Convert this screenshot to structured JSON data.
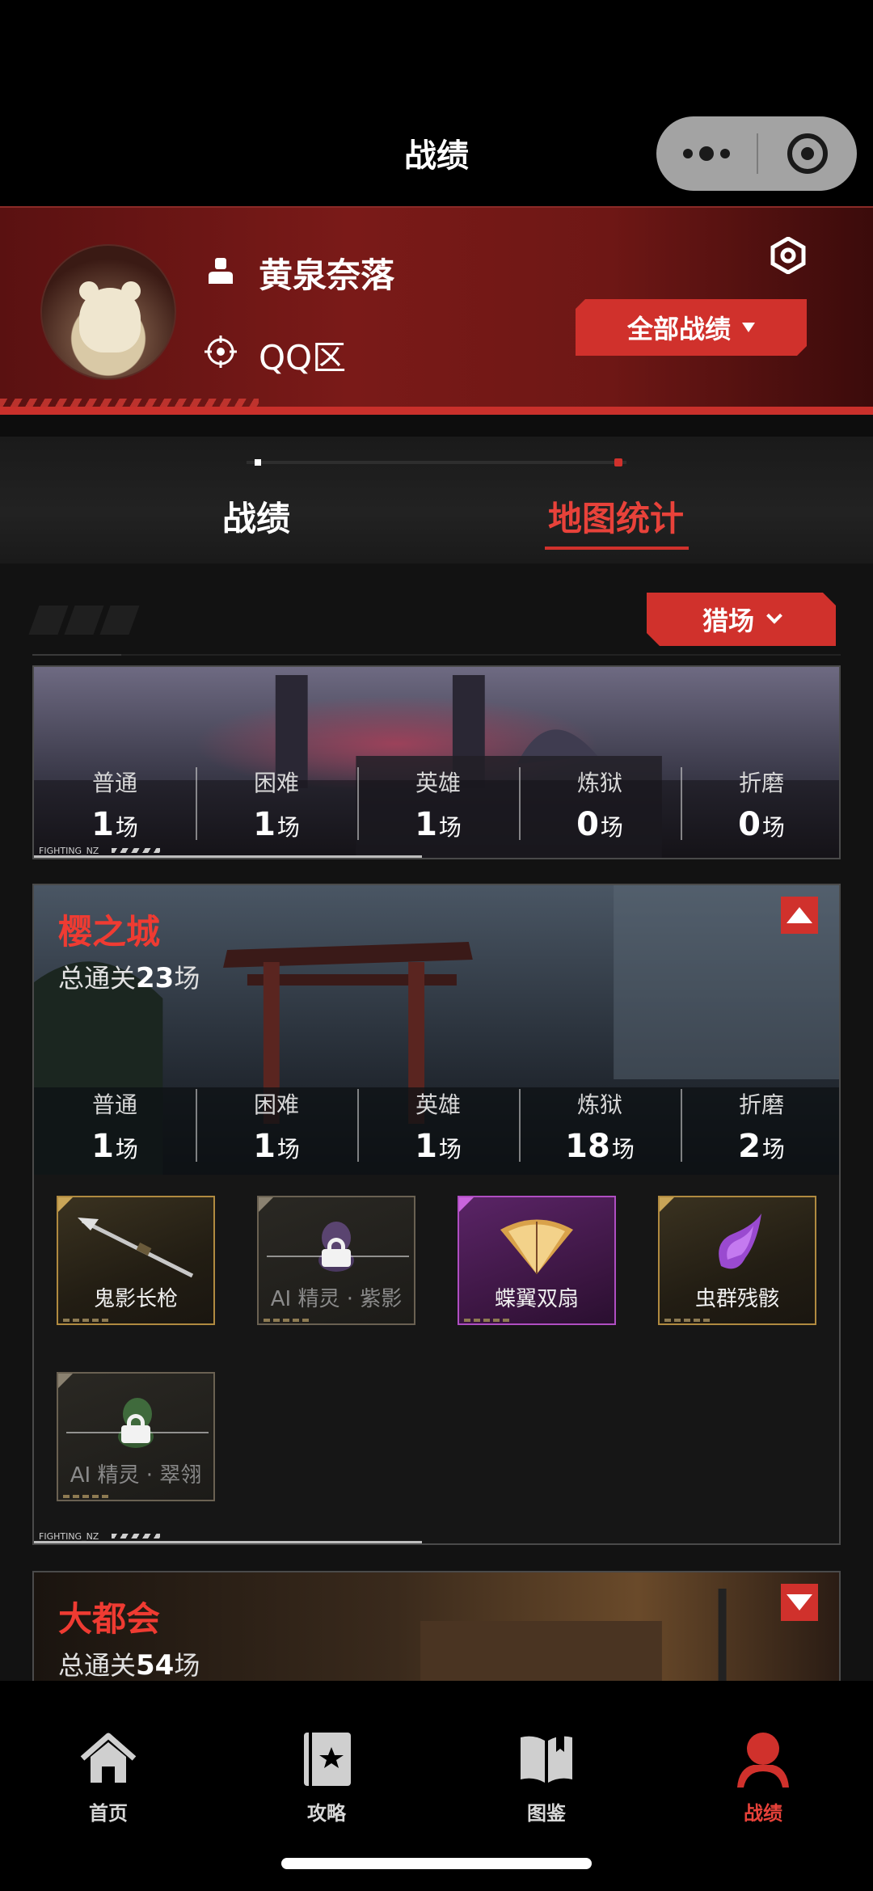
{
  "nav": {
    "title": "战绩"
  },
  "profile": {
    "username": "黄泉奈落",
    "region": "QQ区",
    "all_records_button": "全部战绩"
  },
  "tabs": [
    {
      "label": "战绩",
      "active": false
    },
    {
      "label": "地图统计",
      "active": true
    }
  ],
  "filter": {
    "mode": "猎场"
  },
  "difficulty_labels": [
    "普通",
    "困难",
    "英雄",
    "炼狱",
    "折磨"
  ],
  "unit": "场",
  "maps": [
    {
      "name": "",
      "stats": [
        1,
        1,
        1,
        0,
        0
      ],
      "footer_tag": "FIGHTING_NZ"
    },
    {
      "name": "樱之城",
      "total_label": "总通关",
      "total": 23,
      "expanded": true,
      "stats": [
        1,
        1,
        1,
        18,
        2
      ],
      "rewards": [
        {
          "name": "鬼影长枪",
          "locked": false,
          "rarity": "gold"
        },
        {
          "name": "AI 精灵 · 紫影",
          "locked": true,
          "rarity": "gold"
        },
        {
          "name": "蝶翼双扇",
          "locked": false,
          "rarity": "purple"
        },
        {
          "name": "虫群残骸",
          "locked": false,
          "rarity": "gold"
        },
        {
          "name": "AI 精灵 · 翠翎",
          "locked": true,
          "rarity": "gold"
        }
      ],
      "footer_tag": "FIGHTING_NZ"
    },
    {
      "name": "大都会",
      "total_label": "总通关",
      "total": 54,
      "expanded": false
    }
  ],
  "bottom_nav": [
    {
      "label": "首页",
      "icon": "home-icon",
      "active": false
    },
    {
      "label": "攻略",
      "icon": "guide-book-icon",
      "active": false
    },
    {
      "label": "图鉴",
      "icon": "open-book-icon",
      "active": false
    },
    {
      "label": "战绩",
      "icon": "user-icon",
      "active": true
    }
  ],
  "colors": {
    "accent": "#d0312c",
    "accent_text": "#e8423a",
    "header_bg": "#6e1715"
  }
}
